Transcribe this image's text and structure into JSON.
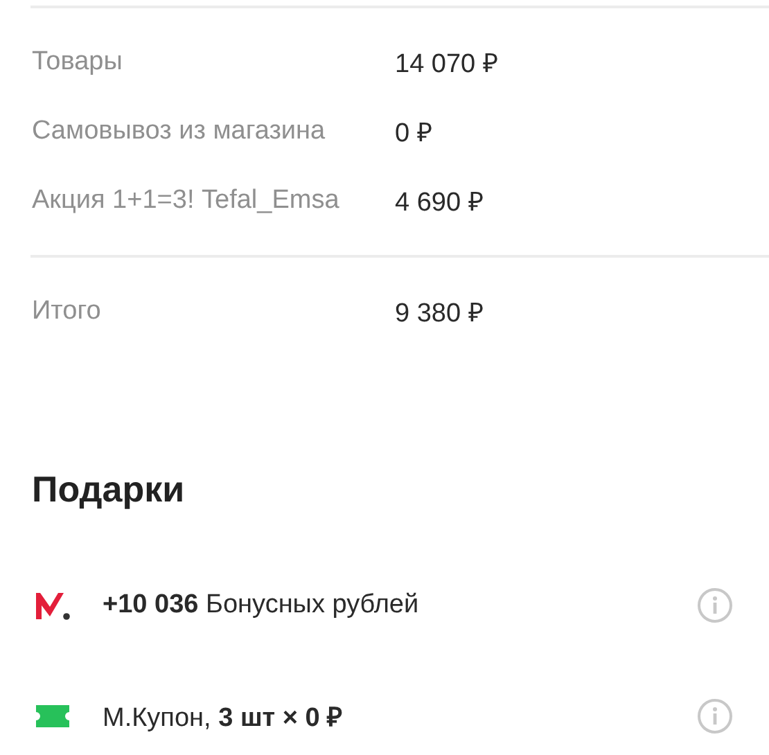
{
  "summary": [
    {
      "label": "Товары",
      "value": "14 070 ₽"
    },
    {
      "label": "Самовывоз из магазина",
      "value": "0 ₽"
    },
    {
      "label": "Акция 1+1=3! Tefal_Emsa",
      "value": "4 690 ₽"
    }
  ],
  "total": {
    "label": "Итого",
    "value": "9 380 ₽"
  },
  "gifts": {
    "title": "Подарки",
    "items": [
      {
        "kind": "bonus",
        "text": "**+10 036** Бонусных рублей"
      },
      {
        "kind": "coupon",
        "text": "М.Купон, **3 шт × 0 ₽**"
      }
    ]
  }
}
